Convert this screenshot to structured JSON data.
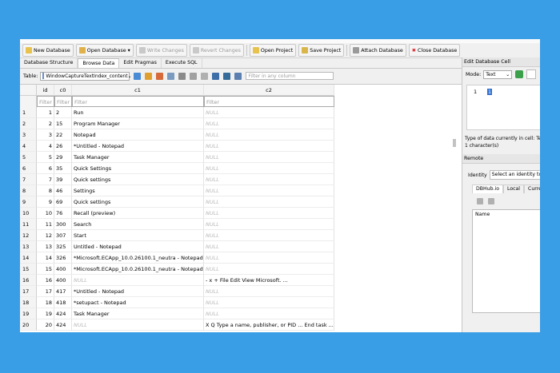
{
  "toolbar": {
    "new_database": "New Database",
    "open_database": "Open Database",
    "write_changes": "Write Changes",
    "revert_changes": "Revert Changes",
    "open_project": "Open Project",
    "save_project": "Save Project",
    "attach_database": "Attach Database",
    "close_database": "Close Database"
  },
  "tabs": [
    "Database Structure",
    "Browse Data",
    "Edit Pragmas",
    "Execute SQL"
  ],
  "table_bar": {
    "label": "Table:",
    "table_name": "WindowCaptureTextIndex_content",
    "filter_placeholder": "Filter in any column"
  },
  "grid": {
    "headers": [
      "id",
      "c0",
      "c1",
      "c2"
    ],
    "filter_placeholder": "Filter",
    "null_text": "NULL",
    "rows": [
      {
        "n": "1",
        "id": "1",
        "c0": "2",
        "c1": "Run",
        "c2": null
      },
      {
        "n": "2",
        "id": "2",
        "c0": "15",
        "c1": "Program Manager",
        "c2": null
      },
      {
        "n": "3",
        "id": "3",
        "c0": "22",
        "c1": "Notepad",
        "c2": null
      },
      {
        "n": "4",
        "id": "4",
        "c0": "26",
        "c1": "*Untitled - Notepad",
        "c2": null
      },
      {
        "n": "5",
        "id": "5",
        "c0": "29",
        "c1": "Task Manager",
        "c2": null
      },
      {
        "n": "6",
        "id": "6",
        "c0": "35",
        "c1": "Quick Settings",
        "c2": null
      },
      {
        "n": "7",
        "id": "7",
        "c0": "39",
        "c1": "Quick settings",
        "c2": null
      },
      {
        "n": "8",
        "id": "8",
        "c0": "46",
        "c1": "Settings",
        "c2": null
      },
      {
        "n": "9",
        "id": "9",
        "c0": "69",
        "c1": "Quick settings",
        "c2": null
      },
      {
        "n": "10",
        "id": "10",
        "c0": "76",
        "c1": "Recall (preview)",
        "c2": null
      },
      {
        "n": "11",
        "id": "11",
        "c0": "300",
        "c1": "Search",
        "c2": null
      },
      {
        "n": "12",
        "id": "12",
        "c0": "307",
        "c1": "Start",
        "c2": null
      },
      {
        "n": "13",
        "id": "13",
        "c0": "325",
        "c1": "Untitled - Notepad",
        "c2": null
      },
      {
        "n": "14",
        "id": "14",
        "c0": "326",
        "c1": "*Microsoft.ECApp_10.0.26100.1_neutra - Notepad",
        "c2": null
      },
      {
        "n": "15",
        "id": "15",
        "c0": "400",
        "c1": "*Microsoft.ECApp_10.0.26100.1_neutra - Notepad",
        "c2": null
      },
      {
        "n": "16",
        "id": "16",
        "c0": "400",
        "c1": null,
        "c2": "- x + File Edit View Microsoft. ..."
      },
      {
        "n": "17",
        "id": "17",
        "c0": "417",
        "c1": "*Untitled - Notepad",
        "c2": null
      },
      {
        "n": "18",
        "id": "18",
        "c0": "418",
        "c1": "*setupact - Notepad",
        "c2": null
      },
      {
        "n": "19",
        "id": "19",
        "c0": "424",
        "c1": "Task Manager",
        "c2": null
      },
      {
        "n": "20",
        "id": "20",
        "c0": "424",
        "c1": null,
        "c2": "X Q Type a name, publisher, or PID ... End task ...."
      }
    ]
  },
  "edit_cell": {
    "title": "Edit Database Cell",
    "mode_label": "Mode:",
    "mode_value": "Text",
    "line_number": "1",
    "cell_value": "1",
    "type_info_line1": "Type of data currently in cell: Text",
    "type_info_line2": "1 character(s)"
  },
  "remote": {
    "title": "Remote",
    "identity_label": "Identity",
    "identity_value": "Select an identity to co",
    "tabs": [
      "DBHub.io",
      "Local",
      "Curren"
    ],
    "name_header": "Name"
  },
  "colors": {
    "background": "#3a9ee6",
    "accent": "#3070d0",
    "close_red": "#d9262c",
    "icon_green": "#3aa04a"
  }
}
